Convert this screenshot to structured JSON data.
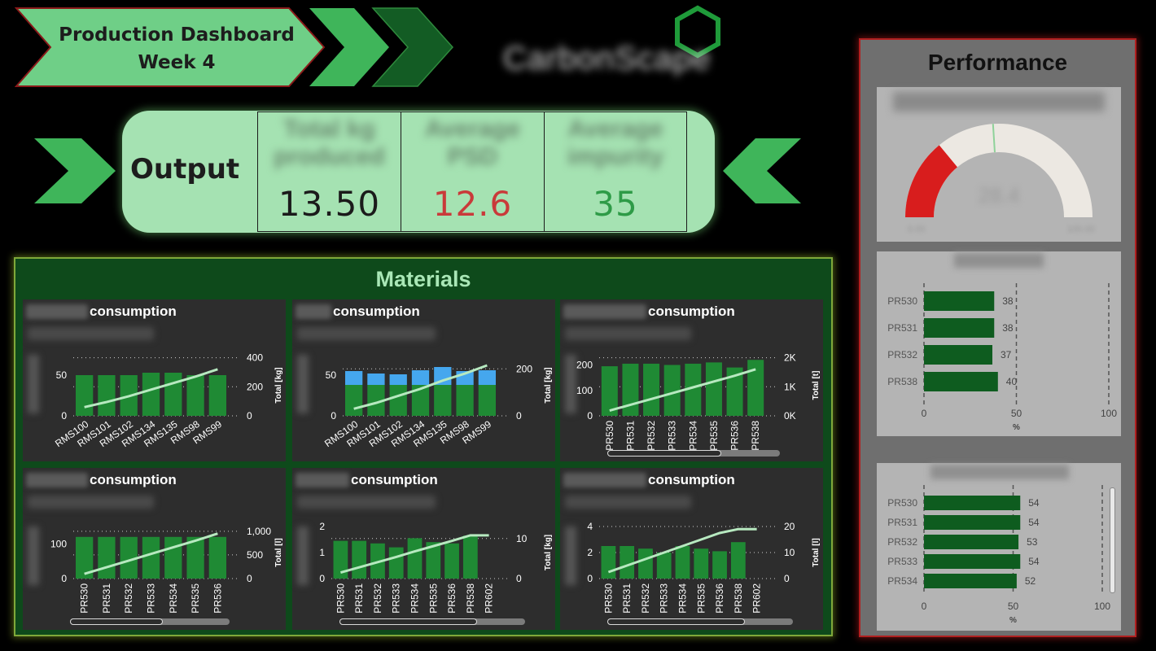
{
  "header": {
    "title_line1": "Production Dashboard",
    "title_line2": "Week 4",
    "brand": "CarbonScape"
  },
  "output": {
    "label": "Output",
    "kpis": [
      {
        "title": "Total kg produced",
        "value": "13.50",
        "color": "#1b1b1b"
      },
      {
        "title": "Average PSD",
        "value": "12.6",
        "color": "#c93a3a"
      },
      {
        "title": "Average impurity",
        "value": "35",
        "color": "#2e9b47"
      }
    ]
  },
  "materials": {
    "title": "Materials",
    "panels": [
      {
        "title_suffix": "consumption",
        "right_axis_label": "Total [kg]",
        "categories": [
          "RMS100",
          "RMS101",
          "RMS102",
          "RMS134",
          "RMS135",
          "RMS98",
          "RMS99"
        ],
        "left_ticks": [
          "50",
          "0"
        ],
        "right_ticks": [
          "400",
          "200",
          "0"
        ],
        "rotated": true,
        "scroll": false,
        "bars": [
          50,
          50,
          50,
          53,
          53,
          50,
          50
        ],
        "left_max": 75,
        "line": [
          60,
          95,
          135,
          180,
          225,
          270,
          320
        ],
        "right_max": 420
      },
      {
        "title_suffix": "consumption",
        "right_axis_label": "Total [kg]",
        "categories": [
          "RMS100",
          "RMS101",
          "RMS102",
          "RMS134",
          "RMS135",
          "RMS98",
          "RMS99"
        ],
        "left_ticks": [
          "50",
          "0"
        ],
        "right_ticks": [
          "200",
          "0"
        ],
        "rotated": true,
        "scroll": false,
        "bars": [
          38,
          38,
          38,
          38,
          38,
          38,
          38
        ],
        "bars2": [
          17,
          14,
          13,
          18,
          22,
          17,
          18
        ],
        "left_max": 75,
        "line": [
          30,
          55,
          85,
          115,
          150,
          180,
          215
        ],
        "right_max": 260
      },
      {
        "title_suffix": "consumption",
        "right_axis_label": "Total [t]",
        "categories": [
          "PR530",
          "PR531",
          "PR532",
          "PR533",
          "PR534",
          "PR535",
          "PR536",
          "PR538"
        ],
        "left_ticks": [
          "200",
          "100",
          "0"
        ],
        "right_ticks": [
          "2K",
          "1K",
          "0K"
        ],
        "rotated": false,
        "scroll": true,
        "scroll_frac": 0.66,
        "bars": [
          195,
          205,
          205,
          200,
          205,
          210,
          190,
          220
        ],
        "left_max": 240,
        "line": [
          180,
          380,
          580,
          780,
          980,
          1180,
          1380,
          1600
        ],
        "right_max": 2100
      },
      {
        "title_suffix": "consumption",
        "right_axis_label": "Total [l]",
        "categories": [
          "PR530",
          "PR531",
          "PR532",
          "PR533",
          "PR534",
          "PR535",
          "PR536"
        ],
        "left_ticks": [
          "100",
          "0"
        ],
        "right_ticks": [
          "1,000",
          "500",
          "0"
        ],
        "rotated": false,
        "scroll": true,
        "scroll_frac": 0.58,
        "bars": [
          120,
          120,
          120,
          120,
          120,
          120,
          120
        ],
        "left_max": 150,
        "line": [
          100,
          240,
          380,
          520,
          660,
          800,
          950
        ],
        "right_max": 1100
      },
      {
        "title_suffix": "consumption",
        "right_axis_label": "Total [kg]",
        "categories": [
          "PR530",
          "PR531",
          "PR532",
          "PR533",
          "PR534",
          "PR535",
          "PR536",
          "PR538",
          "PR602"
        ],
        "left_ticks": [
          "2",
          "1",
          "0"
        ],
        "right_ticks": [
          "10",
          "0"
        ],
        "rotated": false,
        "scroll": true,
        "scroll_frac": 0.74,
        "bars": [
          1.45,
          1.45,
          1.35,
          1.2,
          1.55,
          1.4,
          1.35,
          1.65,
          0
        ],
        "left_max": 2,
        "line": [
          1.5,
          2.8,
          4.1,
          5.4,
          6.8,
          8.1,
          9.4,
          10.8,
          10.8
        ],
        "right_max": 13
      },
      {
        "title_suffix": "consumption",
        "right_axis_label": "Total [l]",
        "categories": [
          "PR530",
          "PR531",
          "PR532",
          "PR533",
          "PR534",
          "PR535",
          "PR536",
          "PR538",
          "PR602"
        ],
        "left_ticks": [
          "4",
          "2",
          "0"
        ],
        "right_ticks": [
          "20",
          "10",
          "0"
        ],
        "rotated": false,
        "scroll": true,
        "scroll_frac": 0.74,
        "bars": [
          2.5,
          2.5,
          2.3,
          2.0,
          2.5,
          2.3,
          2.1,
          2.8,
          0
        ],
        "left_max": 4,
        "line": [
          2.5,
          5,
          7.5,
          10,
          12.5,
          15,
          17.5,
          19,
          19
        ],
        "right_max": 20
      }
    ]
  },
  "performance": {
    "title": "Performance",
    "gauge": {
      "title": "Average Sphere Yield",
      "value_frac": 0.28,
      "target_frac": 0.48,
      "min": "0.00",
      "max": "100.00",
      "center": "28.4"
    },
    "bars1": {
      "title": "Sphere Yield",
      "axis_label": "%",
      "ticks": [
        "0",
        "50",
        "100"
      ],
      "items": [
        {
          "label": "PR530",
          "value": 38
        },
        {
          "label": "PR531",
          "value": 38
        },
        {
          "label": "PR532",
          "value": 37
        },
        {
          "label": "PR538",
          "value": 40
        }
      ]
    },
    "bars2": {
      "title": "Engineered Yield",
      "axis_label": "%",
      "ticks": [
        "0",
        "50",
        "100"
      ],
      "items": [
        {
          "label": "PR530",
          "value": 54
        },
        {
          "label": "PR531",
          "value": 54
        },
        {
          "label": "PR532",
          "value": 53
        },
        {
          "label": "PR533",
          "value": 54
        },
        {
          "label": "PR534",
          "value": 52
        }
      ]
    }
  }
}
